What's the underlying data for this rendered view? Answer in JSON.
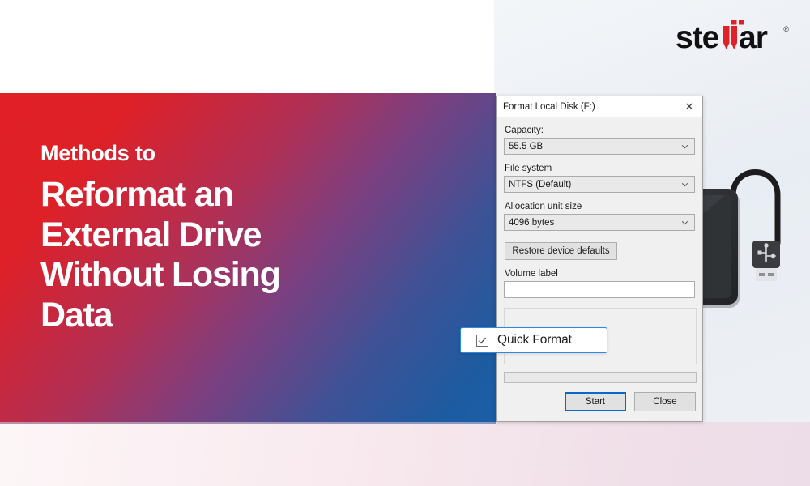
{
  "brand": {
    "logo_text_part1": "ste",
    "logo_text_mark": "ll",
    "logo_text_part2": "ar",
    "logo_trademark": "®",
    "logo_name": "stellar",
    "accent_red": "#E02128",
    "accent_blue": "#1D5BA0",
    "focus_blue": "#0A68C9",
    "callout_border": "#2D8AE0"
  },
  "hero": {
    "kicker": "Methods to",
    "headline_lines": [
      "Reformat an",
      "External Drive",
      "Without Losing",
      "Data"
    ],
    "gradient_from": "#E01F26",
    "gradient_to": "#1A5FA8"
  },
  "dialog": {
    "title": "Format Local Disk (F:)",
    "close_icon": "✕",
    "capacity": {
      "label": "Capacity:",
      "value": "55.5 GB",
      "chevron_icon": "chevron-down-icon"
    },
    "file_system": {
      "label": "File system",
      "value": "NTFS (Default)",
      "chevron_icon": "chevron-down-icon"
    },
    "allocation_unit_size": {
      "label": "Allocation unit size",
      "value": "4096 bytes",
      "chevron_icon": "chevron-down-icon"
    },
    "restore_defaults_label": "Restore device defaults",
    "volume_label": {
      "label": "Volume label",
      "value": "",
      "placeholder": ""
    },
    "progress_value": "",
    "buttons": {
      "start": "Start",
      "close": "Close"
    }
  },
  "callout": {
    "label": "Quick Format",
    "checked": true,
    "check_icon": "checkmark-icon"
  },
  "illustration": {
    "device_name": "external-hard-drive",
    "cable_name": "usb-cable",
    "connector_icon": "usb-trident-icon"
  }
}
